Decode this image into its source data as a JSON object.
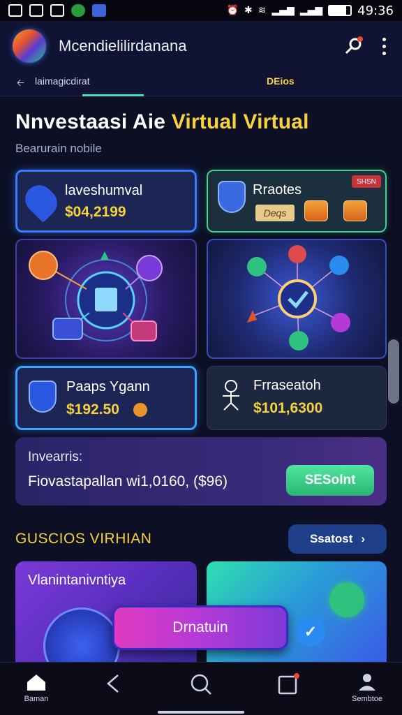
{
  "status_bar": {
    "time": "49:36"
  },
  "header": {
    "app_title": "Mcendielilirdanana"
  },
  "tabs": [
    {
      "label": "laimagicdirat"
    },
    {
      "label": "DEios"
    }
  ],
  "main": {
    "title_prefix": "Nnvestaasi Aie",
    "title_highlight": "Virtual Virtual",
    "subtitle": "Bearurain nobile"
  },
  "cards": {
    "investment": {
      "title": "laveshumval",
      "value": "$04,2199"
    },
    "rates": {
      "title": "Rraotes",
      "tag": "SHSN",
      "pill": "Deqs"
    },
    "payments": {
      "title": "Paaps Ygann",
      "value": "$192.50"
    },
    "transaction": {
      "title": "Frraseatoh",
      "value": "$101,6300"
    }
  },
  "banner": {
    "label": "Invearris:",
    "text": "Fiovastapallan wi1,0160, ($96)",
    "button": "SESolnt"
  },
  "section": {
    "title": "GUSCIOS VIRHIAN",
    "button": "Ssatost"
  },
  "promo": {
    "card_title": "Vlanintanivntiya",
    "float_button": "Drnatuin"
  },
  "nav": [
    {
      "label": "Baman",
      "icon": "home-icon"
    },
    {
      "label": "",
      "icon": "back-icon"
    },
    {
      "label": "",
      "icon": "search-icon"
    },
    {
      "label": "",
      "icon": "square-icon"
    },
    {
      "label": "Sembtoe",
      "icon": "profile-icon"
    }
  ],
  "colors": {
    "accent": "#f6d33d",
    "green": "#2ec27e",
    "blue": "#3a7bff"
  }
}
